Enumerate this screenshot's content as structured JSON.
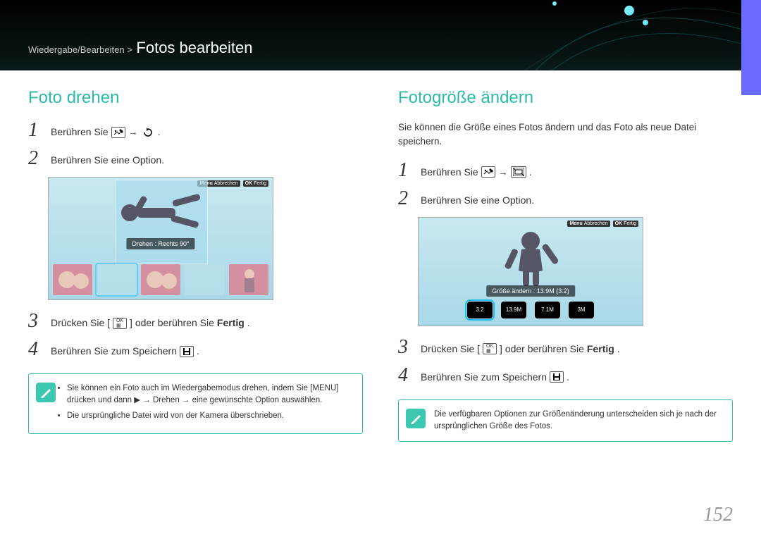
{
  "breadcrumb": "Wiedergabe/Bearbeiten > ",
  "page_title": "Fotos bearbeiten",
  "page_number": "152",
  "left": {
    "title": "Foto drehen",
    "steps": {
      "s1_prefix": "Berühren Sie ",
      "s2": "Berühren Sie eine Option.",
      "s3_prefix": "Drücken Sie [",
      "s3_mid": "] oder berühren Sie ",
      "s3_bold": "Fertig",
      "s4": "Berühren Sie zum Speichern ",
      "period": "."
    },
    "screenshot": {
      "menu_cancel": "Abbrechen",
      "ok_done": "Fertig",
      "overlay": "Drehen : Rechts 90°"
    },
    "note_items": [
      "Sie können ein Foto auch im Wiedergabemodus drehen, indem Sie [MENU] drücken und dann ▶ → Drehen → eine gewünschte Option auswählen.",
      "Die ursprüngliche Datei wird von der Kamera überschrieben."
    ]
  },
  "right": {
    "title": "Fotogröße ändern",
    "desc": "Sie können die Größe eines Fotos ändern und das Foto als neue Datei speichern.",
    "steps": {
      "s1_prefix": "Berühren Sie ",
      "s2": "Berühren Sie eine Option.",
      "s3_prefix": "Drücken Sie [",
      "s3_mid": "] oder berühren Sie ",
      "s3_bold": "Fertig",
      "s4": "Berühren Sie zum Speichern ",
      "period": "."
    },
    "screenshot": {
      "menu_cancel": "Abbrechen",
      "ok_done": "Fertig",
      "overlay": "Größe ändern : 13.9M (3:2)",
      "options": [
        "3:2",
        "13.9M",
        "7.1M",
        "3M"
      ]
    },
    "note": "Die verfügbaren Optionen zur Größenänderung unterscheiden sich je nach der ursprünglichen Größe des Fotos."
  },
  "icons": {
    "arrow": "→",
    "ok": "OK",
    "menu": "Menu"
  }
}
